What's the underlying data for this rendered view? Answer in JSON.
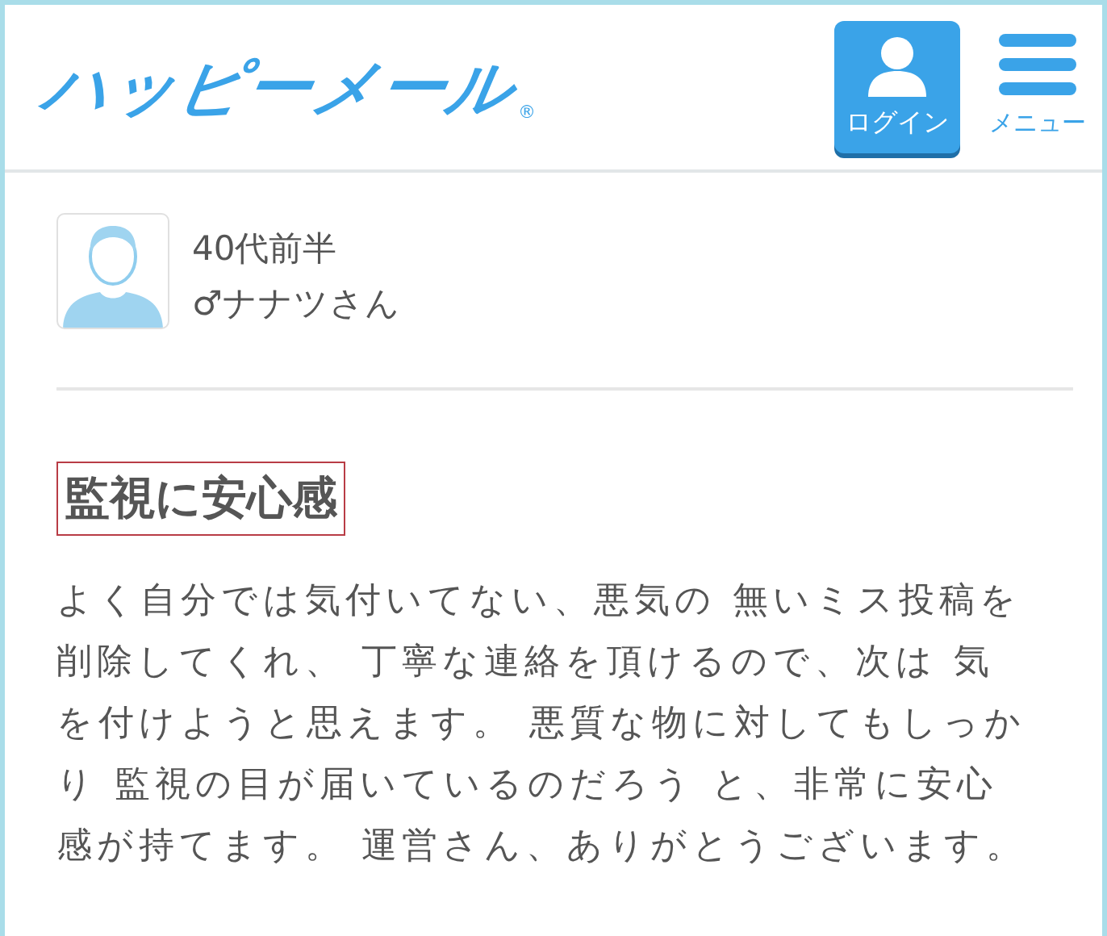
{
  "header": {
    "logo": "ハッピーメール",
    "logo_mark": "®",
    "login_button": "ログイン",
    "menu_button": "メニュー"
  },
  "profile": {
    "age": "40代前半",
    "name": "♂ナナツさん"
  },
  "review": {
    "title": "監視に安心感",
    "body": "よく自分では気付いてない、悪気の 無いミス投稿を削除してくれ、 丁寧な連絡を頂けるので、次は 気を付けようと思えます。 悪質な物に対してもしっかり 監視の目が届いているのだろう と、非常に安心感が持てます。 運営さん、ありがとうございます。"
  }
}
